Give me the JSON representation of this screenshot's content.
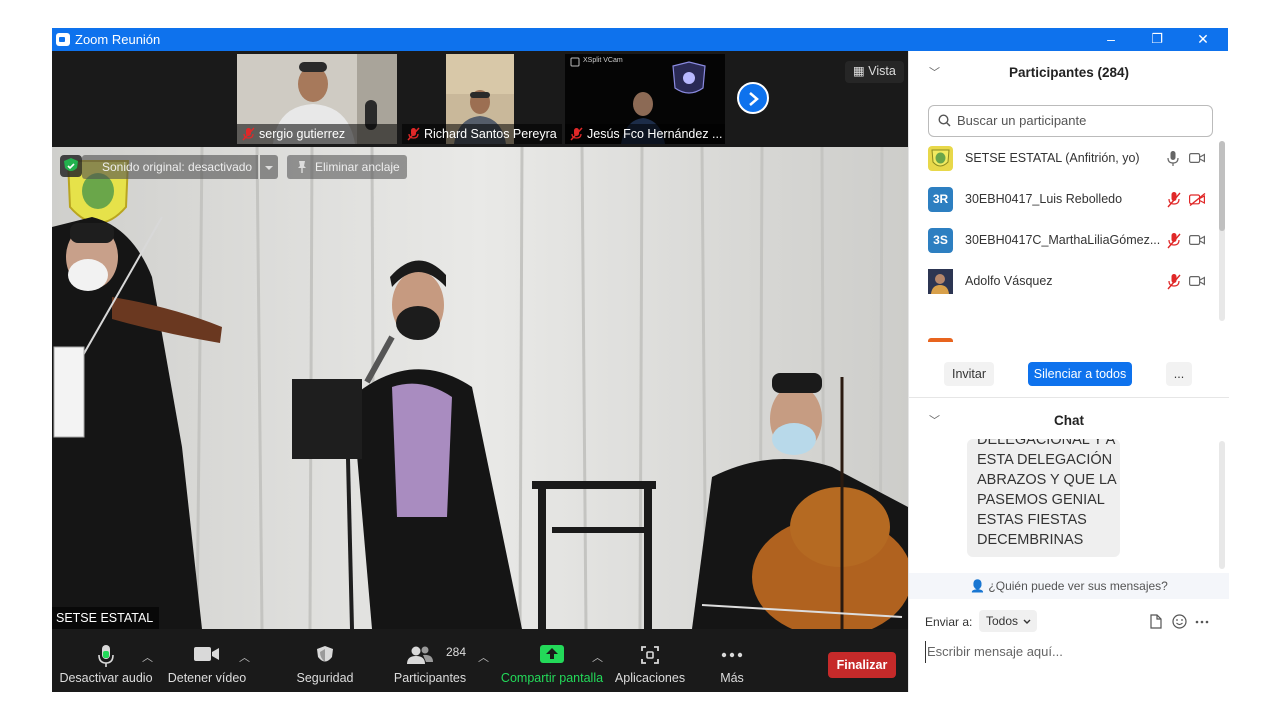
{
  "window": {
    "title": "Zoom Reunión",
    "minimize": "–",
    "maximize": "❐",
    "close": "✕"
  },
  "thumbnails": [
    {
      "name": "sergio gutierrez",
      "muted": true
    },
    {
      "name": "Richard Santos Pereyra",
      "muted": true
    },
    {
      "name": "Jesús Fco Hernández ...",
      "muted": true
    }
  ],
  "third_thumb_overlay": "XSplit VCam",
  "view_button": "Vista",
  "main_video": {
    "speaker": "SETSE ESTATAL",
    "original_sound": "Sonido original: desactivado",
    "unpin": "Eliminar anclaje"
  },
  "toolbar": {
    "audio": "Desactivar audio",
    "video": "Detener vídeo",
    "security": "Seguridad",
    "participants": "Participantes",
    "participants_count": "284",
    "share": "Compartir pantalla",
    "apps": "Aplicaciones",
    "more": "Más",
    "end": "Finalizar"
  },
  "participants_panel": {
    "title": "Participantes (284)",
    "search_placeholder": "Buscar un participante",
    "list": [
      {
        "avatar": "",
        "name": "SETSE ESTATAL (Anfitrión, yo)",
        "avatar_color": "#e8d84a",
        "mic_muted": false,
        "cam_off": false
      },
      {
        "avatar": "3R",
        "name": "30EBH0417_Luis Rebolledo",
        "avatar_color": "#2d7fc1",
        "mic_muted": true,
        "cam_off": true
      },
      {
        "avatar": "3S",
        "name": "30EBH0417C_MarthaLiliaGómez...",
        "avatar_color": "#2d7fc1",
        "mic_muted": true,
        "cam_off": false
      },
      {
        "avatar": "",
        "name": "Adolfo Vásquez",
        "avatar_color": "#3b4a6a",
        "mic_muted": true,
        "cam_off": false
      }
    ],
    "invite": "Invitar",
    "mute_all": "Silenciar a todos",
    "more": "..."
  },
  "chat_panel": {
    "title": "Chat",
    "message_lines": [
      "DELEGACIONAL Y A",
      "ESTA DELEGACIÓN",
      "ABRAZOS Y QUE LA",
      "PASEMOS GENIAL",
      "ESTAS FIESTAS",
      "DECEMBRINAS"
    ],
    "who_can_see": "¿Quién puede ver sus mensajes?",
    "send_to_label": "Enviar a:",
    "send_to_value": "Todos",
    "input_placeholder": "Escribir mensaje aquí..."
  },
  "colors": {
    "titlebar": "#0e72ed",
    "accent_blue": "#0e72ed",
    "end_red": "#c62a2a",
    "share_green": "#23d959",
    "mute_red": "#e02828"
  }
}
